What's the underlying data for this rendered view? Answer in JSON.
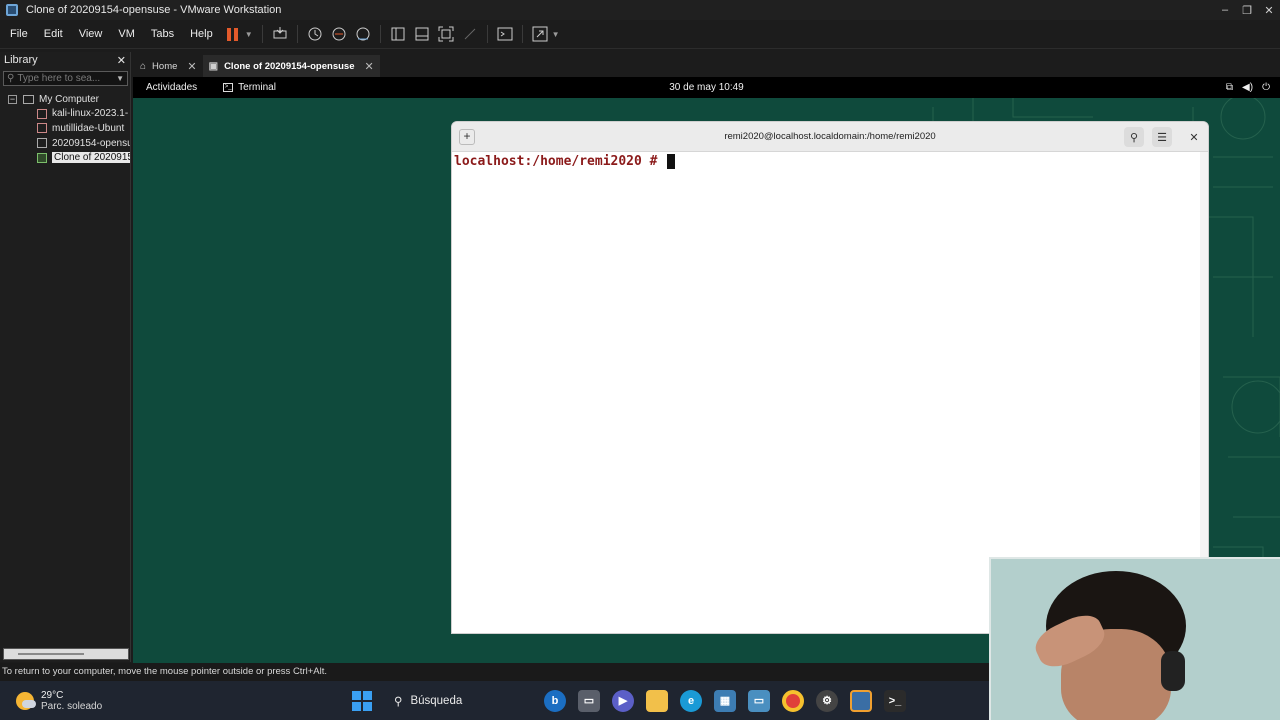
{
  "window": {
    "title": "Clone of 20209154-opensuse - VMware Workstation",
    "controls": [
      "–",
      "❐",
      "✕"
    ]
  },
  "menu": [
    "File",
    "Edit",
    "View",
    "VM",
    "Tabs",
    "Help"
  ],
  "toolbar": {
    "icons": [
      "pause-icon",
      "send-ctrl-alt-del-icon",
      "snapshot-icon",
      "revert-snapshot-icon",
      "snapshot-manager-icon",
      "show-library-icon",
      "thumbnail-bar-icon",
      "fullscreen-icon",
      "unity-icon",
      "console-view-icon",
      "stretch-guest-icon"
    ]
  },
  "library": {
    "title": "Library",
    "search_placeholder": "Type here to sea...",
    "root_label": "My Computer",
    "items": [
      {
        "label": "kali-linux-2023.1-",
        "state": "error"
      },
      {
        "label": "mutillidae-Ubunt",
        "state": "error"
      },
      {
        "label": "20209154-opensu",
        "state": "off"
      },
      {
        "label": "Clone of 2020915",
        "state": "running",
        "selected": true
      }
    ]
  },
  "tabs": [
    {
      "label": "Home",
      "active": false
    },
    {
      "label": "Clone of 20209154-opensuse",
      "active": true
    }
  ],
  "guest": {
    "activities": "Actividades",
    "app_name": "Terminal",
    "clock": "30 de may  10:49",
    "background_color": "#0f4a3c"
  },
  "terminal": {
    "title": "remi2020@localhost.localdomain:/home/remi2020",
    "prompt": "localhost:/home/remi2020 # ",
    "prompt_color": "#8b1a1a"
  },
  "statusbar": {
    "text": "To return to your computer, move the mouse pointer outside or press Ctrl+Alt."
  },
  "taskbar": {
    "temperature": "29°C",
    "weather": "Parc. soleado",
    "search_label": "Búsqueda"
  }
}
